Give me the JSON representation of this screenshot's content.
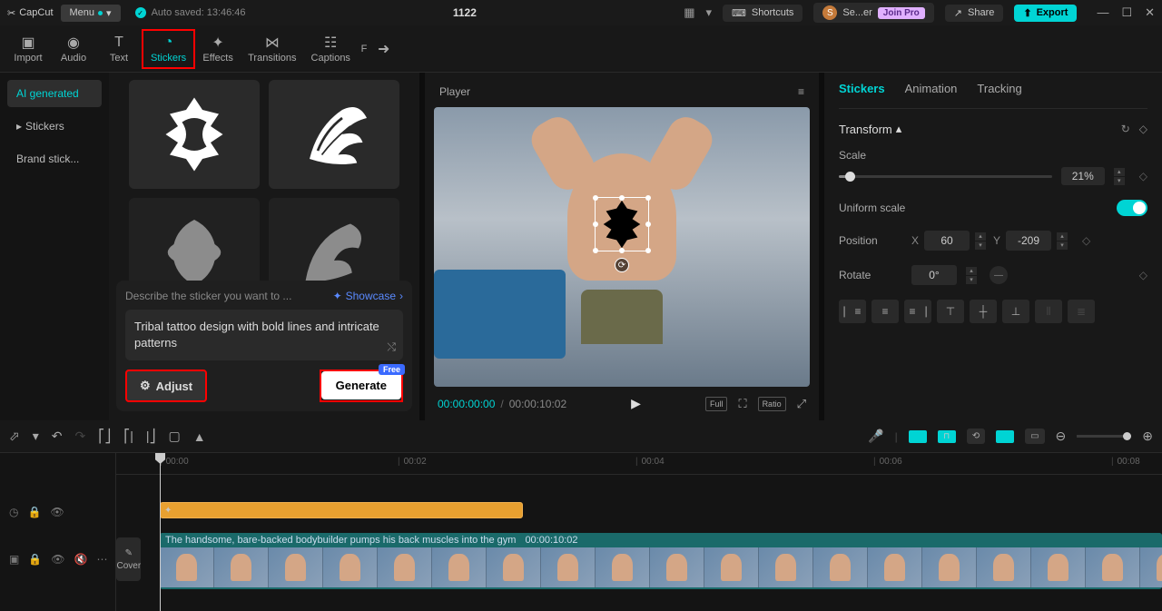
{
  "titlebar": {
    "app_name": "CapCut",
    "menu_label": "Menu",
    "autosave_label": "Auto saved: 13:46:46",
    "project_title": "1122",
    "shortcuts_label": "Shortcuts",
    "user_short": "Se...er",
    "join_pro": "Join Pro",
    "share_label": "Share",
    "export_label": "Export"
  },
  "toolbar": {
    "tabs": [
      {
        "label": "Import"
      },
      {
        "label": "Audio"
      },
      {
        "label": "Text"
      },
      {
        "label": "Stickers",
        "active": true
      },
      {
        "label": "Effects"
      },
      {
        "label": "Transitions"
      },
      {
        "label": "Captions"
      }
    ]
  },
  "left": {
    "sidebar": [
      {
        "label": "AI generated",
        "active": true
      },
      {
        "label": "Stickers"
      },
      {
        "label": "Brand stick..."
      }
    ],
    "ai": {
      "hint": "Describe the sticker you want to ...",
      "showcase": "Showcase",
      "prompt": "Tribal tattoo design with bold lines and intricate patterns",
      "adjust": "Adjust",
      "generate": "Generate",
      "free_badge": "Free"
    }
  },
  "player": {
    "title": "Player",
    "current_time": "00:00:00:00",
    "total_time": "00:00:10:02",
    "full": "Full",
    "ratio": "Ratio"
  },
  "right": {
    "tabs": [
      {
        "label": "Stickers",
        "active": true
      },
      {
        "label": "Animation"
      },
      {
        "label": "Tracking"
      }
    ],
    "transform": "Transform",
    "scale_label": "Scale",
    "scale_value": "21%",
    "uniform_label": "Uniform scale",
    "position_label": "Position",
    "pos_x_label": "X",
    "pos_x_value": "60",
    "pos_y_label": "Y",
    "pos_y_value": "-209",
    "rotate_label": "Rotate",
    "rotate_value": "0°"
  },
  "timeline": {
    "ticks": [
      "00:00",
      "00:02",
      "00:04",
      "00:06",
      "00:08"
    ],
    "cover": "Cover",
    "clip_label": "The handsome, bare-backed bodybuilder pumps his back muscles into the gym",
    "clip_duration": "00:00:10:02"
  }
}
